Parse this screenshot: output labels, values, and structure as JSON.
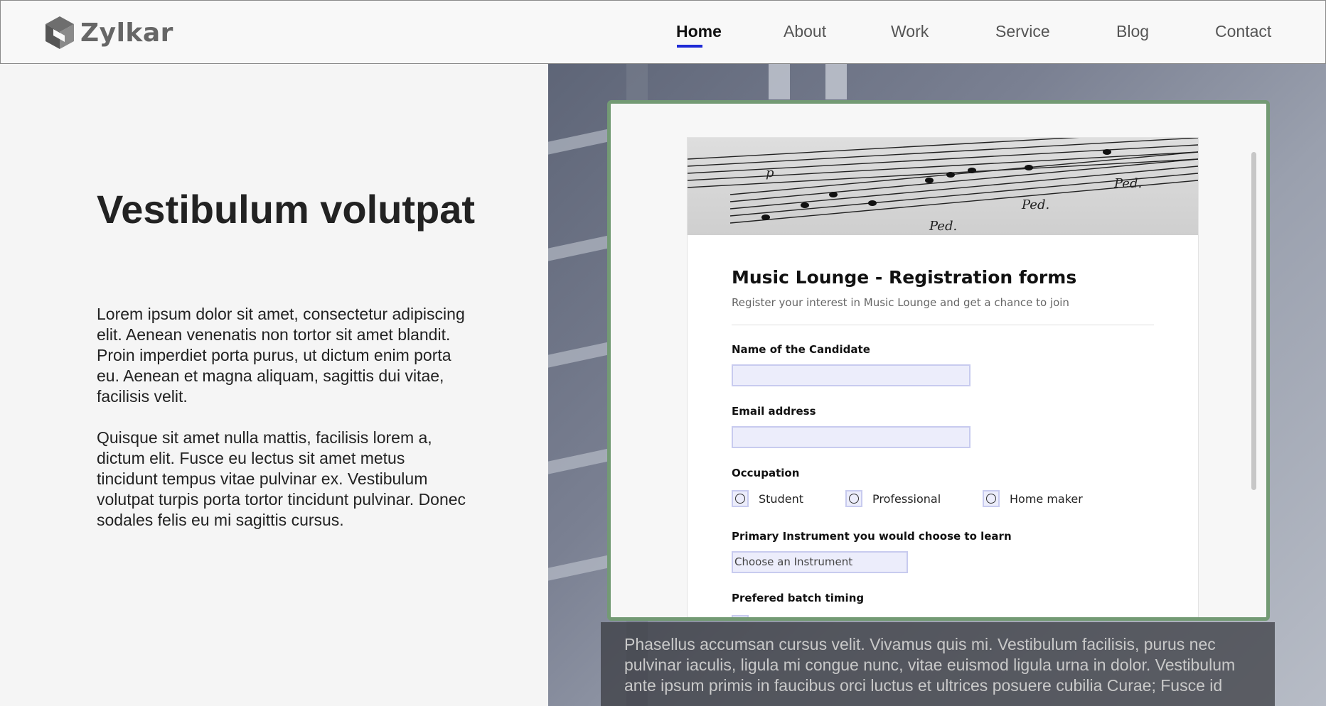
{
  "header": {
    "brand": "Zylkar",
    "nav": [
      {
        "label": "Home",
        "active": true
      },
      {
        "label": "About",
        "active": false
      },
      {
        "label": "Work",
        "active": false
      },
      {
        "label": "Service",
        "active": false
      },
      {
        "label": "Blog",
        "active": false
      },
      {
        "label": "Contact",
        "active": false
      }
    ],
    "accent_color": "#1f2bd6"
  },
  "hero": {
    "title": "Vestibulum volutpat",
    "paragraph1": "Lorem ipsum dolor sit amet, consectetur adipiscing elit. Aenean venenatis non tortor sit amet blandit. Proin imperdiet porta purus, ut dictum enim porta eu. Aenean et magna aliquam, sagittis dui vitae, facilisis velit.",
    "paragraph2": "Quisque sit amet nulla mattis, facilisis lorem a, dictum elit. Fusce eu lectus sit amet metus tincidunt tempus vitae pulvinar ex. Vestibulum volutpat turpis porta tortor tincidunt pulvinar. Donec sodales felis eu mi sagittis cursus."
  },
  "form": {
    "title": "Music Lounge - Registration forms",
    "subtitle": "Register your interest in Music Lounge and get a chance to join",
    "name_label": "Name of the Candidate",
    "name_value": "",
    "email_label": "Email address",
    "email_value": "",
    "occupation_label": "Occupation",
    "occupation_options": [
      "Student",
      "Professional",
      "Home maker"
    ],
    "instrument_label": "Primary Instrument you would choose to learn",
    "instrument_value": "Choose an Instrument",
    "batch_label": "Prefered batch timing",
    "frame_border_color": "#739a74"
  },
  "caption": {
    "text": "Phasellus accumsan cursus velit. Vivamus quis mi. Vestibulum facilisis, purus nec pulvinar iaculis, ligula mi congue nunc, vitae euismod ligula urna in dolor. Vestibulum ante ipsum primis in faucibus orci luctus et ultrices posuere cubilia Curae; Fusce id"
  }
}
